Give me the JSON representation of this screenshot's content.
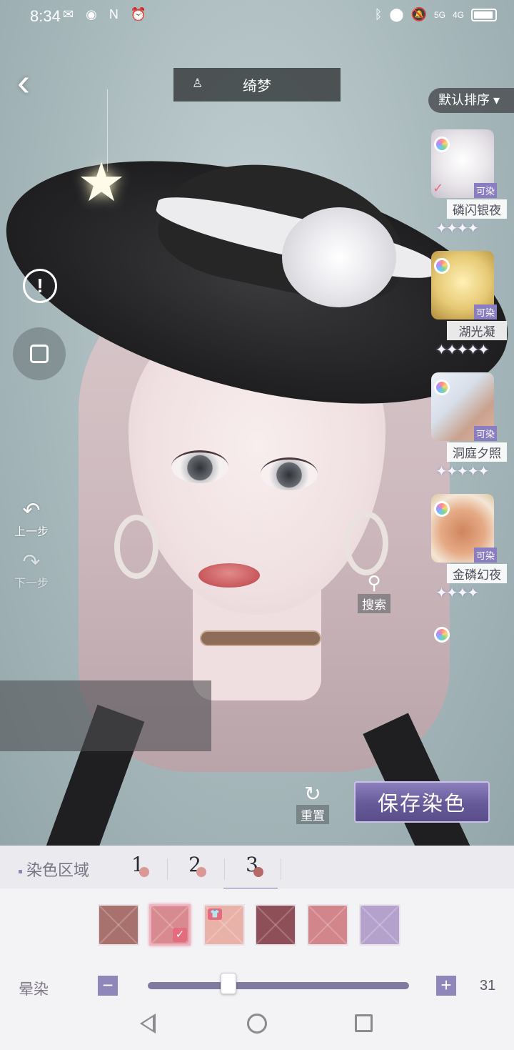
{
  "status_bar": {
    "time": "8:34",
    "left_icons": [
      "wechat-icon",
      "eye-icon",
      "nfc-icon",
      "alarm-icon"
    ],
    "right_icons": [
      "bluetooth-icon",
      "location-icon",
      "mute-icon",
      "5g-signal-icon",
      "4g-signal-icon",
      "battery-icon"
    ],
    "network_5g": "5G",
    "network_4g": "4G"
  },
  "header": {
    "title": "绮梦",
    "sort_label": "默认排序 ▾"
  },
  "side_controls": {
    "undo_label": "上一步",
    "redo_label": "下一步",
    "search_label": "搜索",
    "reset_label": "重置"
  },
  "items": [
    {
      "name": "磷闪银夜",
      "dyeable": "可染",
      "selected": true,
      "stars": "✦✦✦✦"
    },
    {
      "name": "湖光凝",
      "dyeable": "可染",
      "selected": false,
      "stars": "✦✦✦✦✦"
    },
    {
      "name": "洞庭夕照",
      "dyeable": "可染",
      "selected": false,
      "stars": "✦✦✦✦✦"
    },
    {
      "name": "金磷幻夜",
      "dyeable": "可染",
      "selected": false,
      "stars": "✦✦✦✦"
    }
  ],
  "save_button": "保存染色",
  "dye_panel": {
    "section_label": "染色区域",
    "tabs": [
      "1",
      "2",
      "3"
    ],
    "active_tab": "3",
    "swatches": [
      {
        "color": "#a9716d",
        "selected": false
      },
      {
        "color": "#d78b90",
        "selected": true
      },
      {
        "color": "#e9b2a9",
        "selected": false,
        "badge": "shirt-icon"
      },
      {
        "color": "#8e4f58",
        "selected": false
      },
      {
        "color": "#d3858c",
        "selected": false
      },
      {
        "color": "#b4a2cc",
        "selected": false
      }
    ],
    "blend_label": "晕染",
    "blend_value": "31",
    "blend_fraction": 0.31
  },
  "colors": {
    "accent": "#8f86ba",
    "save_button": "#665a99"
  }
}
